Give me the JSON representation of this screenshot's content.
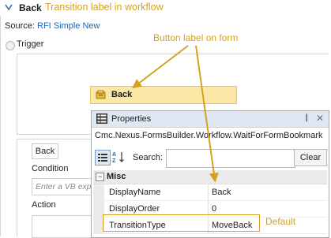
{
  "header": {
    "title": "Back",
    "annotation": "Transition  label in workflow"
  },
  "source": {
    "label": "Source:",
    "link": "RFI Simple New"
  },
  "trigger": {
    "label": "Trigger",
    "bookmark_label": "Back"
  },
  "callouts": {
    "button_label_on_form": "Button label on form",
    "default": "Default"
  },
  "action_section": {
    "button_label": "Back",
    "condition_label": "Condition",
    "condition_placeholder": "Enter a VB expr",
    "action_label": "Action"
  },
  "properties": {
    "title": "Properties",
    "pin": "❙",
    "close": "✕",
    "object_type": "Cmc.Nexus.FormsBuilder.Workflow.WaitForFormBookmark",
    "search_label": "Search:",
    "search_value": "",
    "clear_label": "Clear",
    "category": "Misc",
    "category_toggle": "−",
    "rows": [
      {
        "name": "DisplayName",
        "value": "Back"
      },
      {
        "name": "DisplayOrder",
        "value": "0"
      },
      {
        "name": "TransitionType",
        "value": "MoveBack"
      }
    ]
  },
  "colors": {
    "annotation": "#d6a11f",
    "link": "#1a64b8",
    "bookmark_fill": "#fbe8a6"
  }
}
